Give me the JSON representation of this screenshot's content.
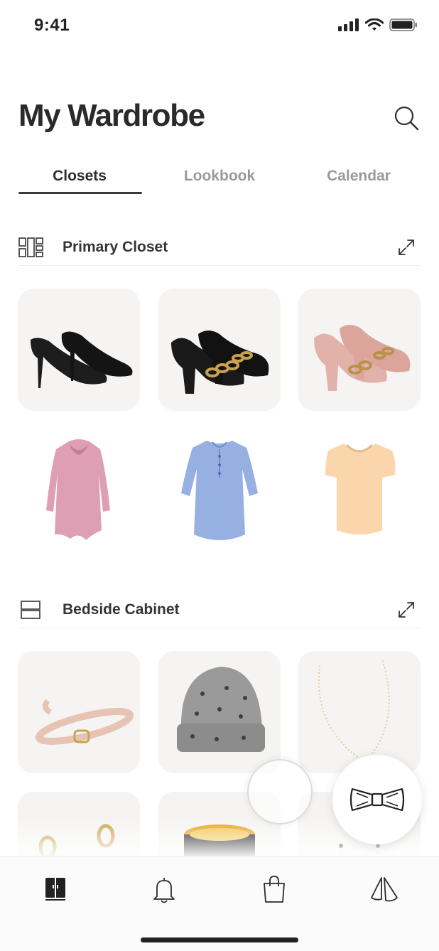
{
  "status_bar": {
    "time": "9:41"
  },
  "header": {
    "title": "My Wardrobe"
  },
  "tabs": [
    {
      "label": "Closets",
      "active": true
    },
    {
      "label": "Lookbook",
      "active": false
    },
    {
      "label": "Calendar",
      "active": false
    }
  ],
  "sections": [
    {
      "title": "Primary Closet",
      "icon": "closet-layout-icon",
      "items": [
        "black-suede-pumps",
        "black-chain-loafer-pumps",
        "pink-chain-loafer-pumps",
        "pink-cowl-neck-tunic",
        "blue-henley-tunic",
        "peach-scoop-tee"
      ]
    },
    {
      "title": "Bedside Cabinet",
      "icon": "cabinet-layout-icon",
      "items": [
        "blush-studded-belt",
        "grey-jeweled-beanie",
        "pearl-necklace",
        "gold-rings",
        "black-gold-bangle",
        "drop-earrings"
      ]
    }
  ],
  "fab": {
    "icon": "bow-tie-icon"
  },
  "tab_bar": {
    "items": [
      {
        "icon": "wardrobe-icon",
        "active": true
      },
      {
        "icon": "bell-icon",
        "active": false
      },
      {
        "icon": "shopping-bag-icon",
        "active": false
      },
      {
        "icon": "hangers-icon",
        "active": false
      }
    ]
  },
  "colors": {
    "text": "#2b2b2b",
    "muted": "#9a9a9a",
    "tile": "#f5f4f2",
    "indicator": "#3a3a3a"
  }
}
